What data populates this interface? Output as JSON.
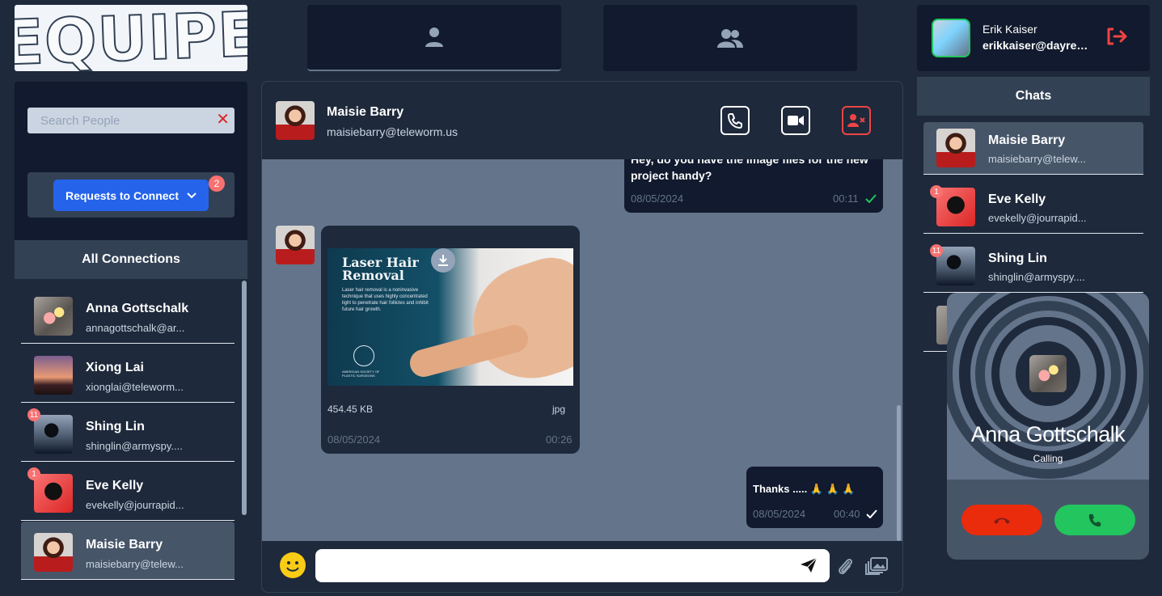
{
  "logo": {
    "text": "EQUIPE"
  },
  "top_tabs": [
    {
      "icon": "user-icon"
    },
    {
      "icon": "users-icon"
    }
  ],
  "user": {
    "name": "Erik Kaiser",
    "email": "erikkaiser@dayrep...",
    "logout_icon": "logout-icon"
  },
  "sidebar": {
    "search": {
      "placeholder": "Search People",
      "value": ""
    },
    "requests": {
      "label": "Requests to Connect",
      "count": "2"
    },
    "all_connections_title": "All Connections",
    "connections": [
      {
        "name": "Anna Gottschalk",
        "email": "annagottschalk@ar...",
        "badge": ""
      },
      {
        "name": "Xiong Lai",
        "email": "xionglai@teleworm...",
        "badge": ""
      },
      {
        "name": "Shing Lin",
        "email": "shinglin@armyspy....",
        "badge": "11"
      },
      {
        "name": "Eve Kelly",
        "email": "evekelly@jourrapid...",
        "badge": "1"
      },
      {
        "name": "Maisie Barry",
        "email": "maisiebarry@telew...",
        "badge": ""
      }
    ]
  },
  "chat": {
    "contact": {
      "name": "Maisie Barry",
      "email": "maisiebarry@teleworm.us"
    },
    "messages": [
      {
        "text": "Hey, do you have the image files for the new project handy?",
        "date": "08/05/2024",
        "time": "00:11"
      },
      {
        "image_title_1": "Laser Hair",
        "image_title_2": "Removal",
        "image_desc": "Laser hair removal is a noninvasive technique that uses highly concentrated light to penetrate hair follicles and inhibit future hair growth.",
        "image_org": "AMERICAN SOCIETY OF PLASTIC SURGEONS",
        "size": "454.45 KB",
        "ext": "jpg",
        "date": "08/05/2024",
        "time": "00:26"
      },
      {
        "text": "Thanks ..... 🙏 🙏 🙏",
        "date": "08/05/2024",
        "time": "00:40"
      }
    ],
    "input": {
      "value": ""
    }
  },
  "chats": {
    "title": "Chats",
    "items": [
      {
        "name": "Maisie Barry",
        "email": "maisiebarry@telew...",
        "badge": ""
      },
      {
        "name": "Eve Kelly",
        "email": "evekelly@jourrapid...",
        "badge": "1"
      },
      {
        "name": "Shing Lin",
        "email": "shinglin@armyspy....",
        "badge": "11"
      }
    ]
  },
  "call": {
    "name": "Anna Gottschalk",
    "status": "Calling",
    "decline_color": "#ea2c0c",
    "accept_color": "#22c55e"
  },
  "colors": {
    "accent": "#2563eb",
    "badge": "#f87171",
    "danger": "#ef4444",
    "online": "#22c55e"
  }
}
